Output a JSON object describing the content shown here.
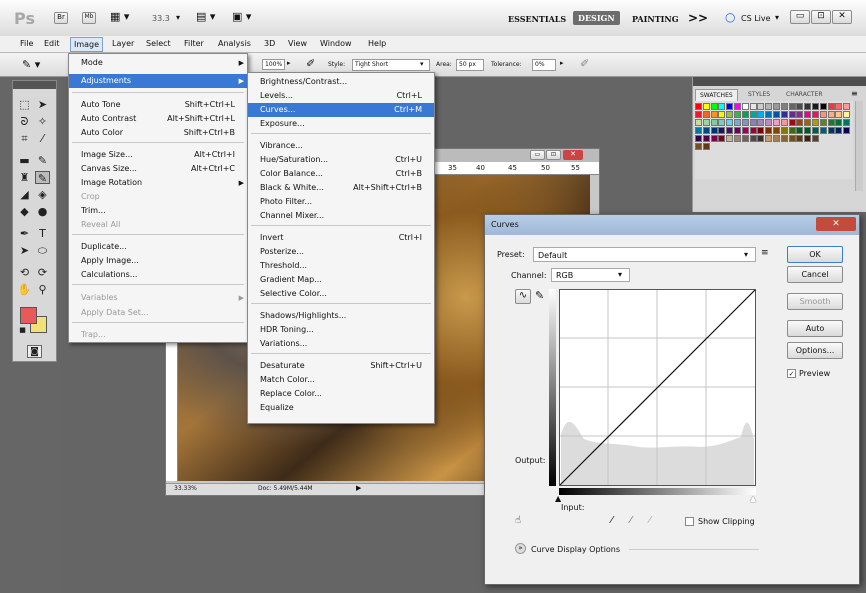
{
  "appbar": {
    "logo": "Ps",
    "zoom": "33.3",
    "workspaces": [
      "ESSENTIALS",
      "DESIGN",
      "PAINTING"
    ],
    "more": ">>",
    "cslive": "CS Live",
    "active_workspace": "DESIGN"
  },
  "menubar": [
    "File",
    "Edit",
    "Image",
    "Layer",
    "Select",
    "Filter",
    "Analysis",
    "3D",
    "View",
    "Window",
    "Help"
  ],
  "optbar": {
    "size": "100%",
    "style_label": "Style:",
    "style_value": "Tight Short",
    "area_label": "Area:",
    "area_value": "50 px",
    "tolerance_label": "Tolerance:",
    "tolerance_value": "0%"
  },
  "image_menu": {
    "items": [
      {
        "label": "Mode",
        "shortcut": "",
        "submenu": true,
        "disabled": false
      },
      {
        "label": "Adjustments",
        "shortcut": "",
        "submenu": true,
        "disabled": false,
        "highlight": true
      },
      {
        "label": "Auto Tone",
        "shortcut": "Shift+Ctrl+L",
        "disabled": false
      },
      {
        "label": "Auto Contrast",
        "shortcut": "Alt+Shift+Ctrl+L",
        "disabled": false
      },
      {
        "label": "Auto Color",
        "shortcut": "Shift+Ctrl+B",
        "disabled": false
      },
      {
        "label": "Image Size...",
        "shortcut": "Alt+Ctrl+I",
        "disabled": false
      },
      {
        "label": "Canvas Size...",
        "shortcut": "Alt+Ctrl+C",
        "disabled": false
      },
      {
        "label": "Image Rotation",
        "shortcut": "",
        "submenu": true,
        "disabled": false
      },
      {
        "label": "Crop",
        "shortcut": "",
        "disabled": true
      },
      {
        "label": "Trim...",
        "shortcut": "",
        "disabled": false
      },
      {
        "label": "Reveal All",
        "shortcut": "",
        "disabled": true
      },
      {
        "label": "Duplicate...",
        "shortcut": "",
        "disabled": false
      },
      {
        "label": "Apply Image...",
        "shortcut": "",
        "disabled": false
      },
      {
        "label": "Calculations...",
        "shortcut": "",
        "disabled": false
      },
      {
        "label": "Variables",
        "shortcut": "",
        "submenu": true,
        "disabled": true
      },
      {
        "label": "Apply Data Set...",
        "shortcut": "",
        "disabled": true
      },
      {
        "label": "Trap...",
        "shortcut": "",
        "disabled": true
      }
    ]
  },
  "adjust_menu": {
    "items": [
      {
        "label": "Brightness/Contrast...",
        "shortcut": ""
      },
      {
        "label": "Levels...",
        "shortcut": "Ctrl+L"
      },
      {
        "label": "Curves...",
        "shortcut": "Ctrl+M",
        "highlight": true
      },
      {
        "label": "Exposure...",
        "shortcut": ""
      },
      {
        "label": "Vibrance...",
        "shortcut": ""
      },
      {
        "label": "Hue/Saturation...",
        "shortcut": "Ctrl+U"
      },
      {
        "label": "Color Balance...",
        "shortcut": "Ctrl+B"
      },
      {
        "label": "Black & White...",
        "shortcut": "Alt+Shift+Ctrl+B"
      },
      {
        "label": "Photo Filter...",
        "shortcut": ""
      },
      {
        "label": "Channel Mixer...",
        "shortcut": ""
      },
      {
        "label": "Invert",
        "shortcut": "Ctrl+I"
      },
      {
        "label": "Posterize...",
        "shortcut": ""
      },
      {
        "label": "Threshold...",
        "shortcut": ""
      },
      {
        "label": "Gradient Map...",
        "shortcut": ""
      },
      {
        "label": "Selective Color...",
        "shortcut": ""
      },
      {
        "label": "Shadows/Highlights...",
        "shortcut": ""
      },
      {
        "label": "HDR Toning...",
        "shortcut": ""
      },
      {
        "label": "Variations...",
        "shortcut": ""
      },
      {
        "label": "Desaturate",
        "shortcut": "Shift+Ctrl+U"
      },
      {
        "label": "Match Color...",
        "shortcut": ""
      },
      {
        "label": "Replace Color...",
        "shortcut": ""
      },
      {
        "label": "Equalize",
        "shortcut": ""
      }
    ]
  },
  "panel": {
    "tabs": [
      "SWATCHES",
      "STYLES",
      "CHARACTER"
    ]
  },
  "docwin": {
    "ruler_ticks": [
      "35",
      "40",
      "45",
      "50",
      "55"
    ],
    "zoom": "33.33%",
    "doc_info": "Doc: 5.49M/5.44M"
  },
  "curves": {
    "title": "Curves",
    "preset_label": "Preset:",
    "preset_value": "Default",
    "channel_label": "Channel:",
    "channel_value": "RGB",
    "output_label": "Output:",
    "input_label": "Input:",
    "show_clipping": "Show Clipping",
    "display_options": "Curve Display Options",
    "buttons": {
      "ok": "OK",
      "cancel": "Cancel",
      "smooth": "Smooth",
      "auto": "Auto",
      "options": "Options..."
    },
    "preview_label": "Preview",
    "preview_checked": true
  }
}
